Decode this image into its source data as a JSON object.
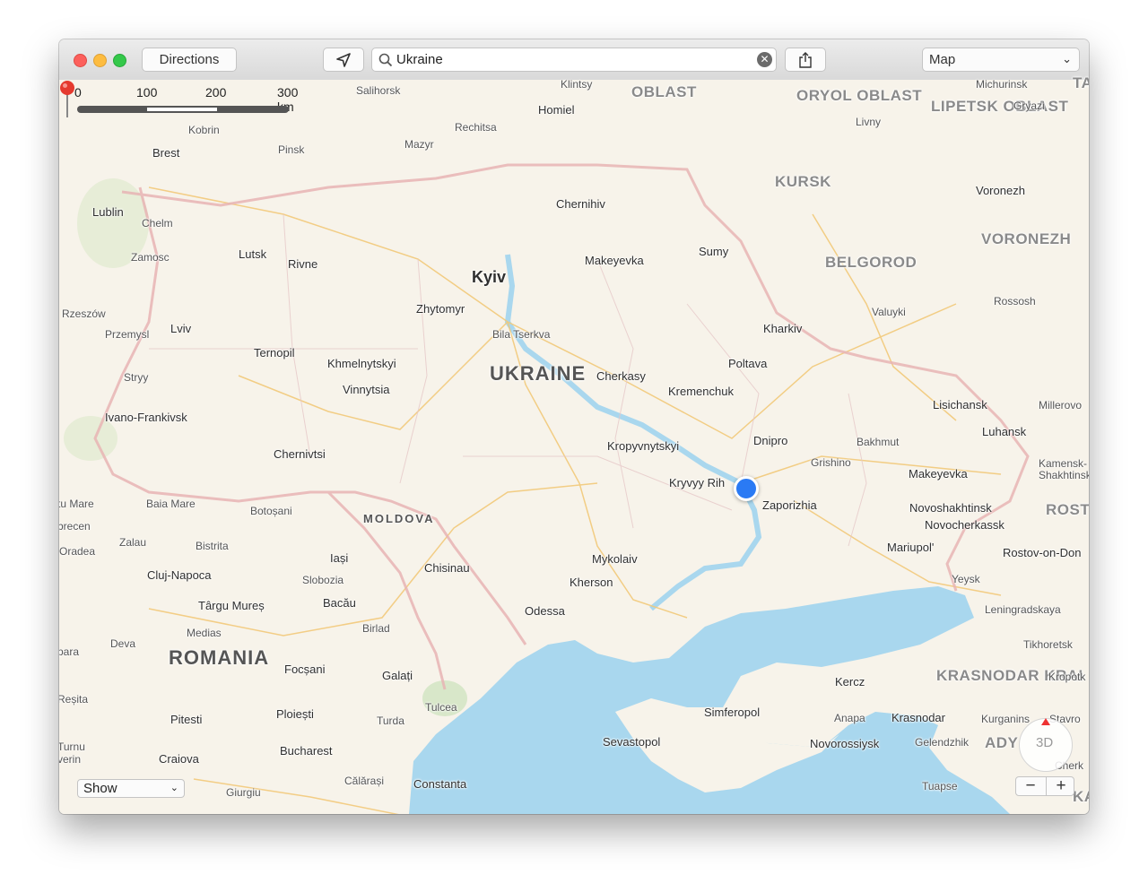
{
  "toolbar": {
    "directions_label": "Directions",
    "search_value": "Ukraine",
    "map_type": "Map",
    "icons": [
      "location-arrow-icon",
      "search-icon",
      "clear-icon",
      "share-icon",
      "chevron-down-icon"
    ]
  },
  "scale": {
    "labels": [
      "0",
      "100",
      "200",
      "300 km"
    ]
  },
  "bottom_left": {
    "show_label": "Show"
  },
  "controls": {
    "three_d_label": "3D",
    "zoom_out": "−",
    "zoom_in": "+"
  },
  "colors": {
    "land": "#f7f3ea",
    "water": "#a9d7ee",
    "border": "#e8b4b4",
    "road": "#f2c97a",
    "pin": "#e53a2f",
    "user": "#2a7af4"
  },
  "map": {
    "country_label": "UKRAINE",
    "moldova_label": "MOLDOVA",
    "romania_label": "ROMANIA",
    "regions": [
      "OBLAST",
      "ORYOL OBLAST",
      "LIPETSK OBLAST",
      "KURSK",
      "BELGOROD",
      "VORONEZH",
      "ROSTO OBLA",
      "KRASNODAR KRAI",
      "ADY"
    ],
    "cities": [
      "Salihorsk",
      "Klintsy",
      "Michurinsk",
      "TAM",
      "Homiel",
      "Livny",
      "Gryazi",
      "Kobrin",
      "Rechitsa",
      "Brest",
      "Pinsk",
      "Mazyr",
      "Voronezh",
      "Chernihiv",
      "Lublin",
      "Chelm",
      "Sumy",
      "Zamosc",
      "Lutsk",
      "Rivne",
      "Makeyevka",
      "Kyiv",
      "Rossosh",
      "Valuyki",
      "Rzeszów",
      "Zhytomyr",
      "Lviv",
      "Przemysl",
      "Bila Tserkva",
      "Kharkiv",
      "Ternopil",
      "Khmelnytskyi",
      "Poltava",
      "Stryy",
      "Cherkasy",
      "Vinnytsia",
      "Kremenchuk",
      "Lisichansk",
      "Millerovo",
      "Ivano-Frankivsk",
      "Luhansk",
      "Dnipro",
      "Bakhmut",
      "Kropyvnytskyi",
      "Grishino",
      "Kamensk-Shakhtinsk",
      "Chernivtsi",
      "Makeyevka",
      "Kryvyy Rih",
      "tu Mare",
      "Baia Mare",
      "Botoșani",
      "Zaporizhia",
      "Novoshakhtinsk",
      "brecen",
      "Novocherkassk",
      "Zalau",
      "Oradea",
      "Bistrita",
      "Iași",
      "Mariupol'",
      "Rostov-on-Don",
      "Cluj-Napoca",
      "Chisinau",
      "Mykolaiv",
      "Slobozia",
      "Yeysk",
      "Kherson",
      "Târgu Mureș",
      "Bacău",
      "Odessa",
      "Leningradskaya",
      "Medias",
      "Birlad",
      "Deva",
      "Tikhoretsk",
      "para",
      "Focșani",
      "Galați",
      "Kropotk",
      "Kercz",
      "Reșita",
      "Tulcea",
      "Pitesti",
      "Ploiești",
      "Simferopol",
      "Anapa",
      "Krasnodar",
      "Kurganins",
      "Stavro",
      "Turda",
      "Sevastopol",
      "Gelendzhik",
      "Novorossiysk",
      "Turnu",
      "verin",
      "Bucharest",
      "Craiova",
      "Cherk",
      "Călărași",
      "Constanta",
      "Giurgiu",
      "Tuapse",
      "KAR"
    ]
  }
}
